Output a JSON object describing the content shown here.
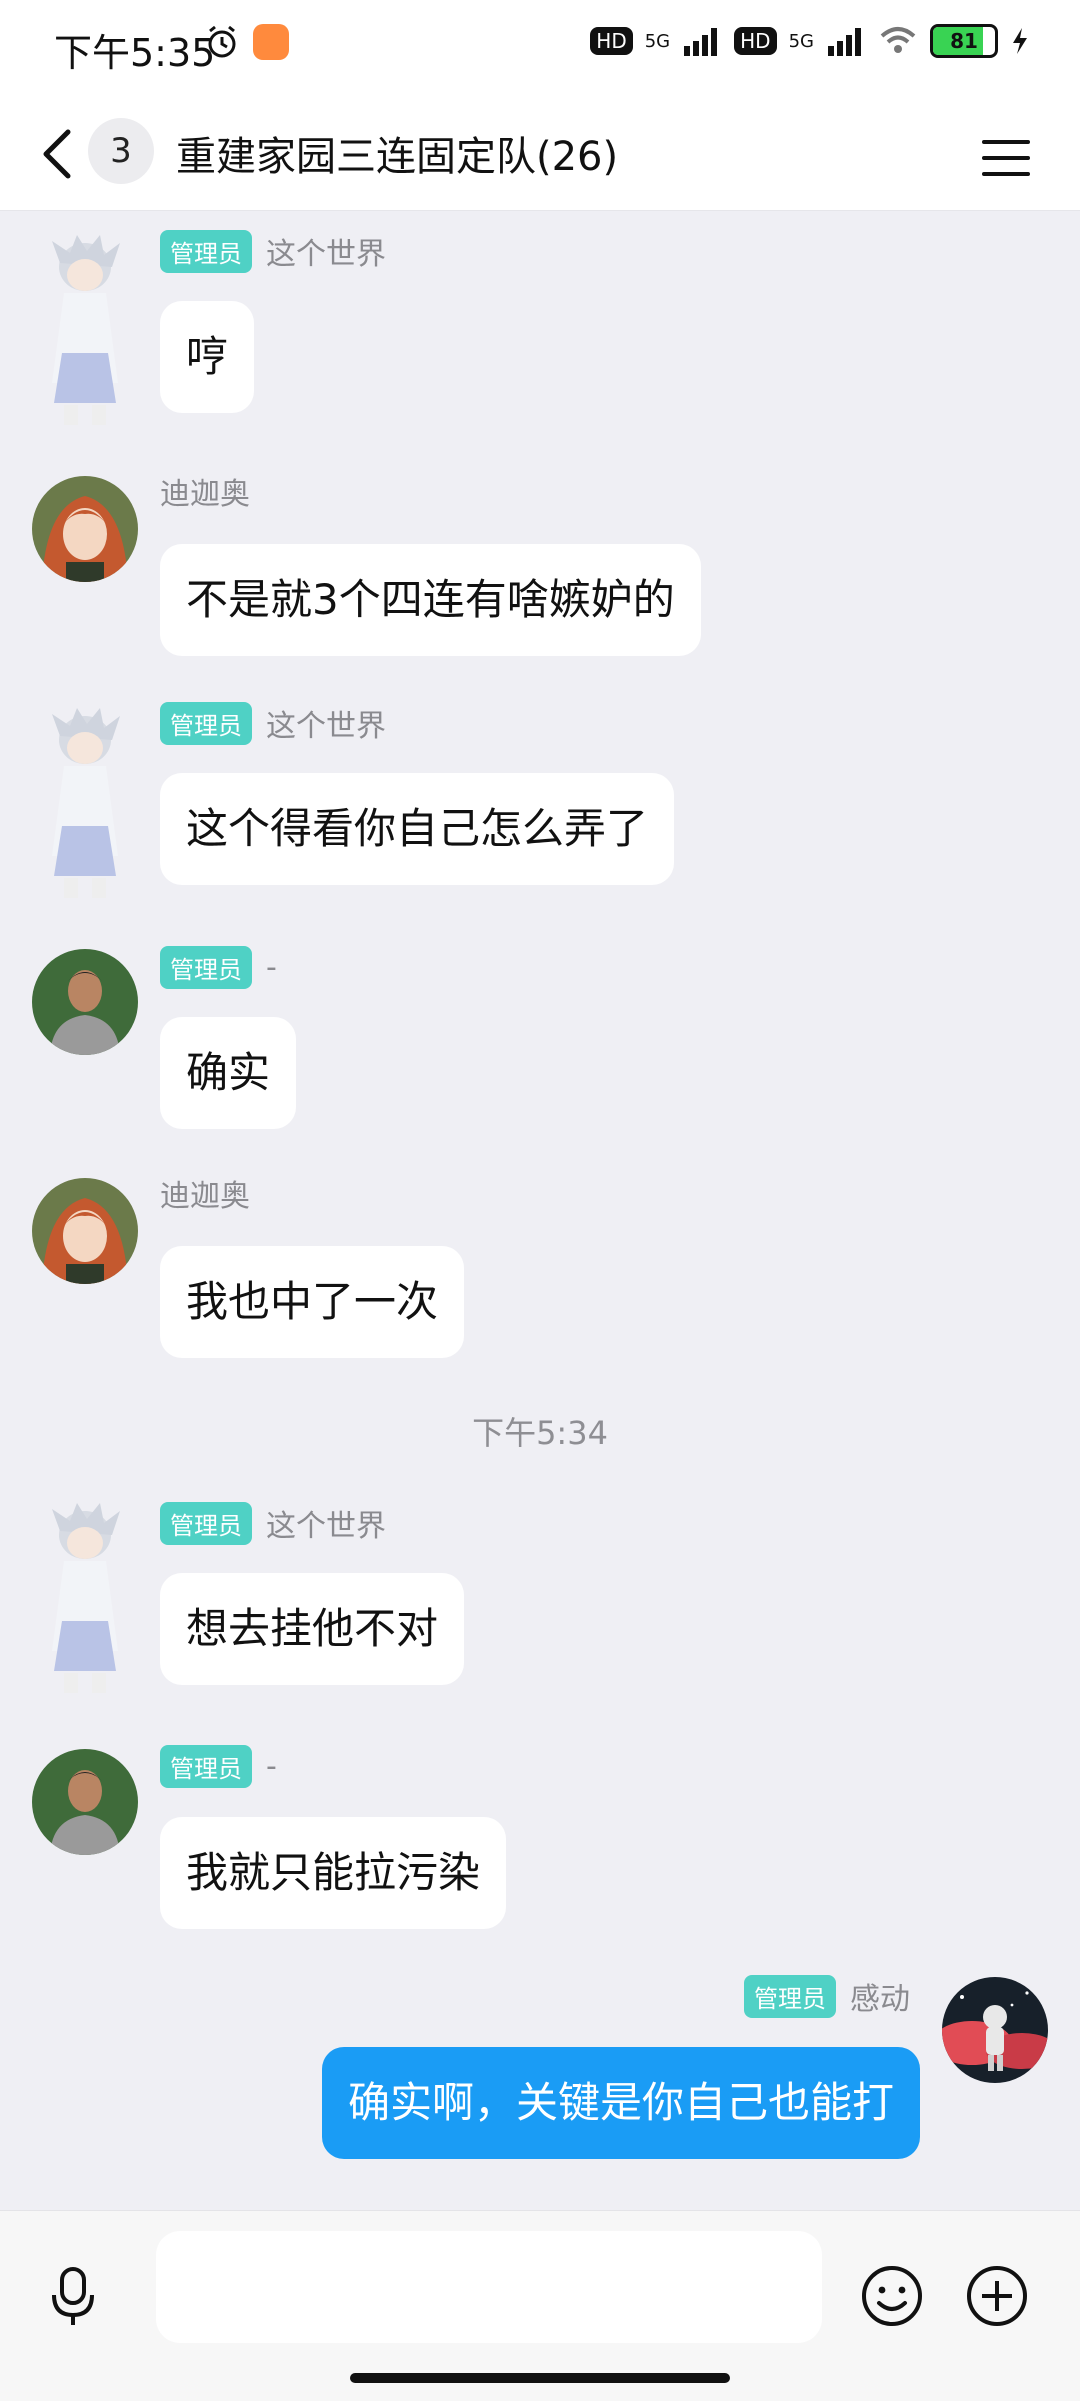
{
  "status": {
    "time": "下午5:35",
    "network_1": "HD",
    "gen_1": "5G",
    "network_2": "HD",
    "gen_2": "5G",
    "battery": "81",
    "battery_level": 0.81,
    "icons": [
      "alarm-icon",
      "app-notification-icon",
      "signal-icon",
      "wifi-icon",
      "charging-icon"
    ]
  },
  "header": {
    "unread_count": "3",
    "title": "重建家园三连固定队(26)"
  },
  "messages": [
    {
      "sender": "这个世界",
      "badge": "管理员",
      "text": "哼"
    },
    {
      "sender": "迪迦奥",
      "badge": "",
      "text": "不是就3个四连有啥嫉妒的"
    },
    {
      "sender": "这个世界",
      "badge": "管理员",
      "text": "这个得看你自己怎么弄了"
    },
    {
      "sender": "-",
      "badge": "管理员",
      "text": "确实"
    },
    {
      "sender": "迪迦奥",
      "badge": "",
      "text": "我也中了一次"
    },
    {
      "sender": "这个世界",
      "badge": "管理员",
      "text": "想去挂他不对"
    },
    {
      "sender": "-",
      "badge": "管理员",
      "text": "我就只能拉污染"
    },
    {
      "sender": "感动",
      "badge": "管理员",
      "text": "确实啊，关键是你自己也能打"
    }
  ],
  "timestamp": "下午5:34",
  "input": {
    "placeholder": ""
  },
  "colors": {
    "accent_bubble": "#1a9cf5",
    "admin_badge": "#4fd1c5",
    "background": "#efeff4"
  }
}
